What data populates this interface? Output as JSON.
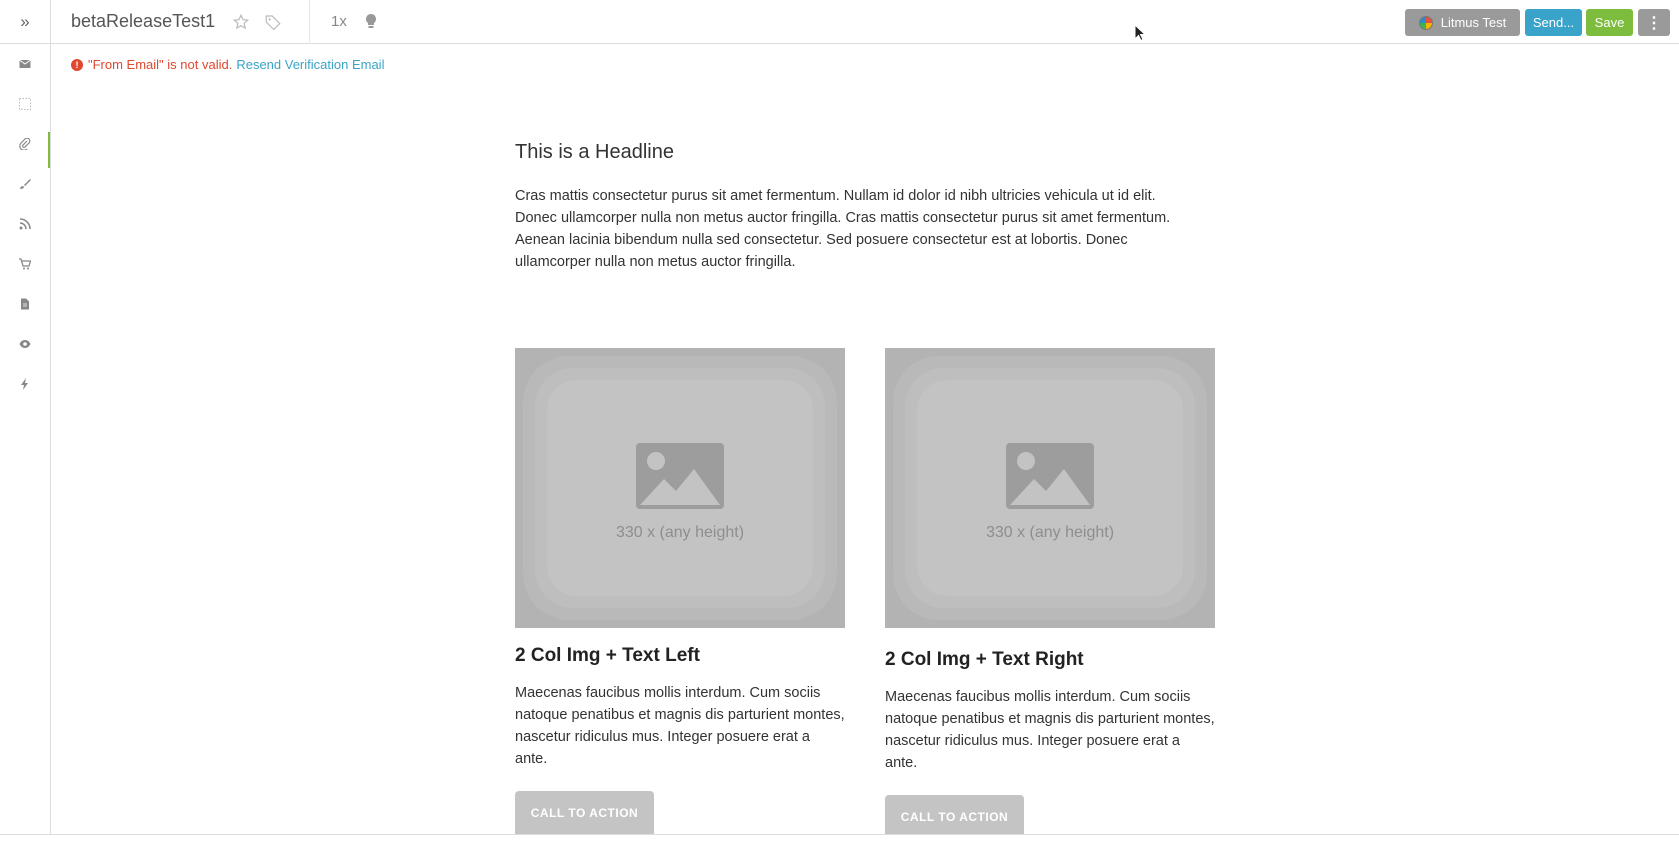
{
  "header": {
    "title": "betaReleaseTest1",
    "zoom": "1x",
    "buttons": {
      "litmus": "Litmus Test",
      "send": "Send...",
      "save": "Save",
      "more": "⋮"
    }
  },
  "sidebar": {
    "items": [
      {
        "icon": "envelope-icon"
      },
      {
        "icon": "layout-grid-icon"
      },
      {
        "icon": "paperclip-icon"
      },
      {
        "icon": "paintbrush-icon"
      },
      {
        "icon": "rss-icon"
      },
      {
        "icon": "cart-icon"
      },
      {
        "icon": "document-icon"
      },
      {
        "icon": "eye-icon"
      },
      {
        "icon": "lightning-icon"
      }
    ]
  },
  "warning": {
    "message": "\"From Email\" is not valid.",
    "link": "Resend Verification Email"
  },
  "content": {
    "headline": "This is a Headline",
    "intro": "Cras mattis consectetur purus sit amet fermentum. Nullam id dolor id nibh ultricies vehicula ut id elit. Donec ullamcorper nulla non metus auctor fringilla. Cras mattis consectetur purus sit amet fermentum. Aenean lacinia bibendum nulla sed consectetur. Sed posuere consectetur est at lobortis. Donec ullamcorper nulla non metus auctor fringilla.",
    "columns": [
      {
        "image_caption": "330 x (any height)",
        "title": "2 Col Img + Text Left",
        "text": "Maecenas faucibus mollis interdum. Cum sociis natoque penatibus et magnis dis parturient montes, nascetur ridiculus mus. Integer posuere erat a ante.",
        "cta": "CALL TO ACTION"
      },
      {
        "image_caption": "330 x (any height)",
        "title": "2 Col Img + Text Right",
        "text": "Maecenas faucibus mollis interdum. Cum sociis natoque penatibus et magnis dis parturient montes, nascetur ridiculus mus. Integer posuere erat a ante.",
        "cta": "CALL TO ACTION"
      }
    ]
  },
  "colors": {
    "accent_green": "#7dbd3e",
    "accent_blue": "#3aa3c9",
    "error_red": "#e0482f",
    "button_gray": "#9a9a9a"
  }
}
